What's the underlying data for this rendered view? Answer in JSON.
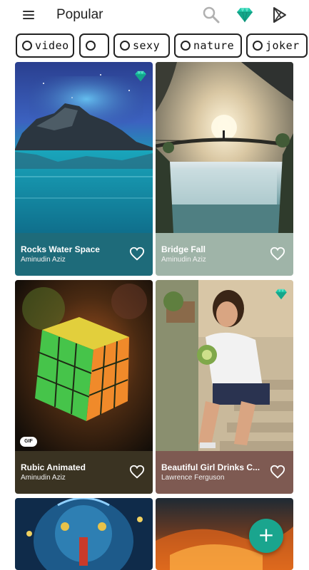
{
  "header": {
    "title": "Popular",
    "icons": [
      "menu-icon",
      "search-icon",
      "diamond-icon",
      "play-store-icon"
    ]
  },
  "chips": [
    {
      "label": "video"
    },
    {
      "label": ""
    },
    {
      "label": "sexy"
    },
    {
      "label": "nature"
    },
    {
      "label": "joker"
    }
  ],
  "cards": [
    {
      "title": "Rocks Water Space",
      "author": "Aminudin Aziz",
      "premium": true,
      "gif": false,
      "info_color": "#1e6b7a"
    },
    {
      "title": "Bridge Fall",
      "author": "Aminudin Aziz",
      "premium": false,
      "gif": false,
      "info_color": "#9fb4a8"
    },
    {
      "title": "Rubic Animated",
      "author": "Aminudin Aziz",
      "premium": false,
      "gif": true,
      "gif_label": "GIF",
      "info_color": "#3a3322"
    },
    {
      "title": "Beautiful Girl Drinks C...",
      "author": "Lawrence Ferguson",
      "premium": true,
      "gif": false,
      "info_color": "#7e5a52"
    }
  ],
  "fab": {
    "label": "+"
  },
  "colors": {
    "accent": "#1aa58e",
    "gem": "#1ec9a8"
  }
}
